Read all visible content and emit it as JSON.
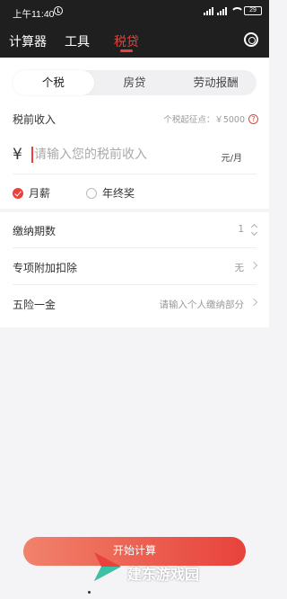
{
  "status_bar": {
    "time": "上午11:40",
    "battery": "29"
  },
  "nav": {
    "tabs": [
      {
        "label": "计算器"
      },
      {
        "label": "工具"
      },
      {
        "label": "税贷"
      }
    ]
  },
  "segments": [
    {
      "label": "个税"
    },
    {
      "label": "房贷"
    },
    {
      "label": "劳动报酬"
    }
  ],
  "income": {
    "label": "税前收入",
    "threshold": "个税起征点：￥5000",
    "currency": "¥",
    "placeholder": "请输入您的税前收入",
    "unit": "元/月"
  },
  "salary_type": {
    "options": [
      {
        "label": "月薪"
      },
      {
        "label": "年终奖"
      }
    ]
  },
  "rows": {
    "periods": {
      "label": "缴纳期数",
      "value": "1"
    },
    "deduction": {
      "label": "专项附加扣除",
      "value": "无"
    },
    "insurance": {
      "label": "五险一金",
      "value": "请输入个人缴纳部分"
    }
  },
  "start_button": "开始计算",
  "watermark": "建东游戏园",
  "colors": {
    "accent": "#e8423b",
    "topbar": "#1f1f1f"
  }
}
